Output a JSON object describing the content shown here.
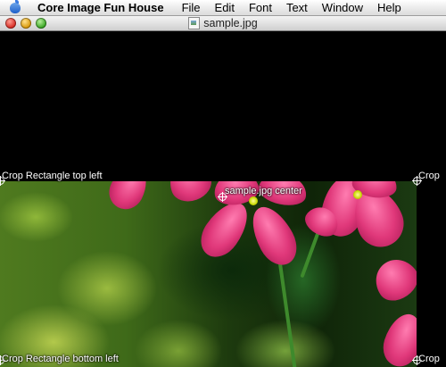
{
  "menubar": {
    "app_name": "Core Image Fun House",
    "items": [
      "File",
      "Edit",
      "Font",
      "Text",
      "Window",
      "Help"
    ]
  },
  "window": {
    "title": "sample.jpg"
  },
  "overlays": {
    "crop_top_left": "Crop Rectangle top left",
    "crop_top_right": "Crop",
    "image_center": "sample.jpg center",
    "crop_bottom_left": "Crop Rectangle bottom left",
    "crop_bottom_right": "Crop"
  },
  "colors": {
    "canvas_background": "#000000",
    "petal": "#e0387a",
    "foliage": "#4f7a1f"
  },
  "icons": {
    "apple": "apple-icon",
    "close": "close-icon",
    "minimize": "minimize-icon",
    "zoom": "zoom-icon",
    "document": "document-icon",
    "crosshair": "crosshair-icon"
  }
}
